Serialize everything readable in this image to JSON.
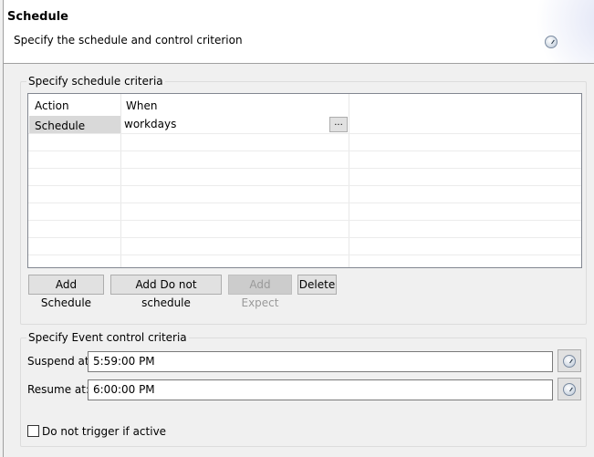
{
  "header": {
    "title": "Schedule",
    "subtitle": "Specify the schedule and control criterion"
  },
  "schedule_group": {
    "legend": "Specify schedule criteria",
    "columns": [
      "Action",
      "When"
    ],
    "rows": [
      {
        "action": "Schedule",
        "when": "workdays"
      }
    ],
    "ellipsis_label": "...",
    "buttons": {
      "add_schedule": "Add Schedule",
      "add_do_not_schedule": "Add Do not schedule",
      "add_expect": "Add Expect",
      "delete": "Delete"
    }
  },
  "event_group": {
    "legend": "Specify Event control criteria",
    "suspend_label": "Suspend at:",
    "suspend_value": "5:59:00 PM",
    "resume_label": "Resume at:",
    "resume_value": "6:00:00 PM",
    "checkbox_label": "Do not trigger if active",
    "checkbox_checked": false
  }
}
